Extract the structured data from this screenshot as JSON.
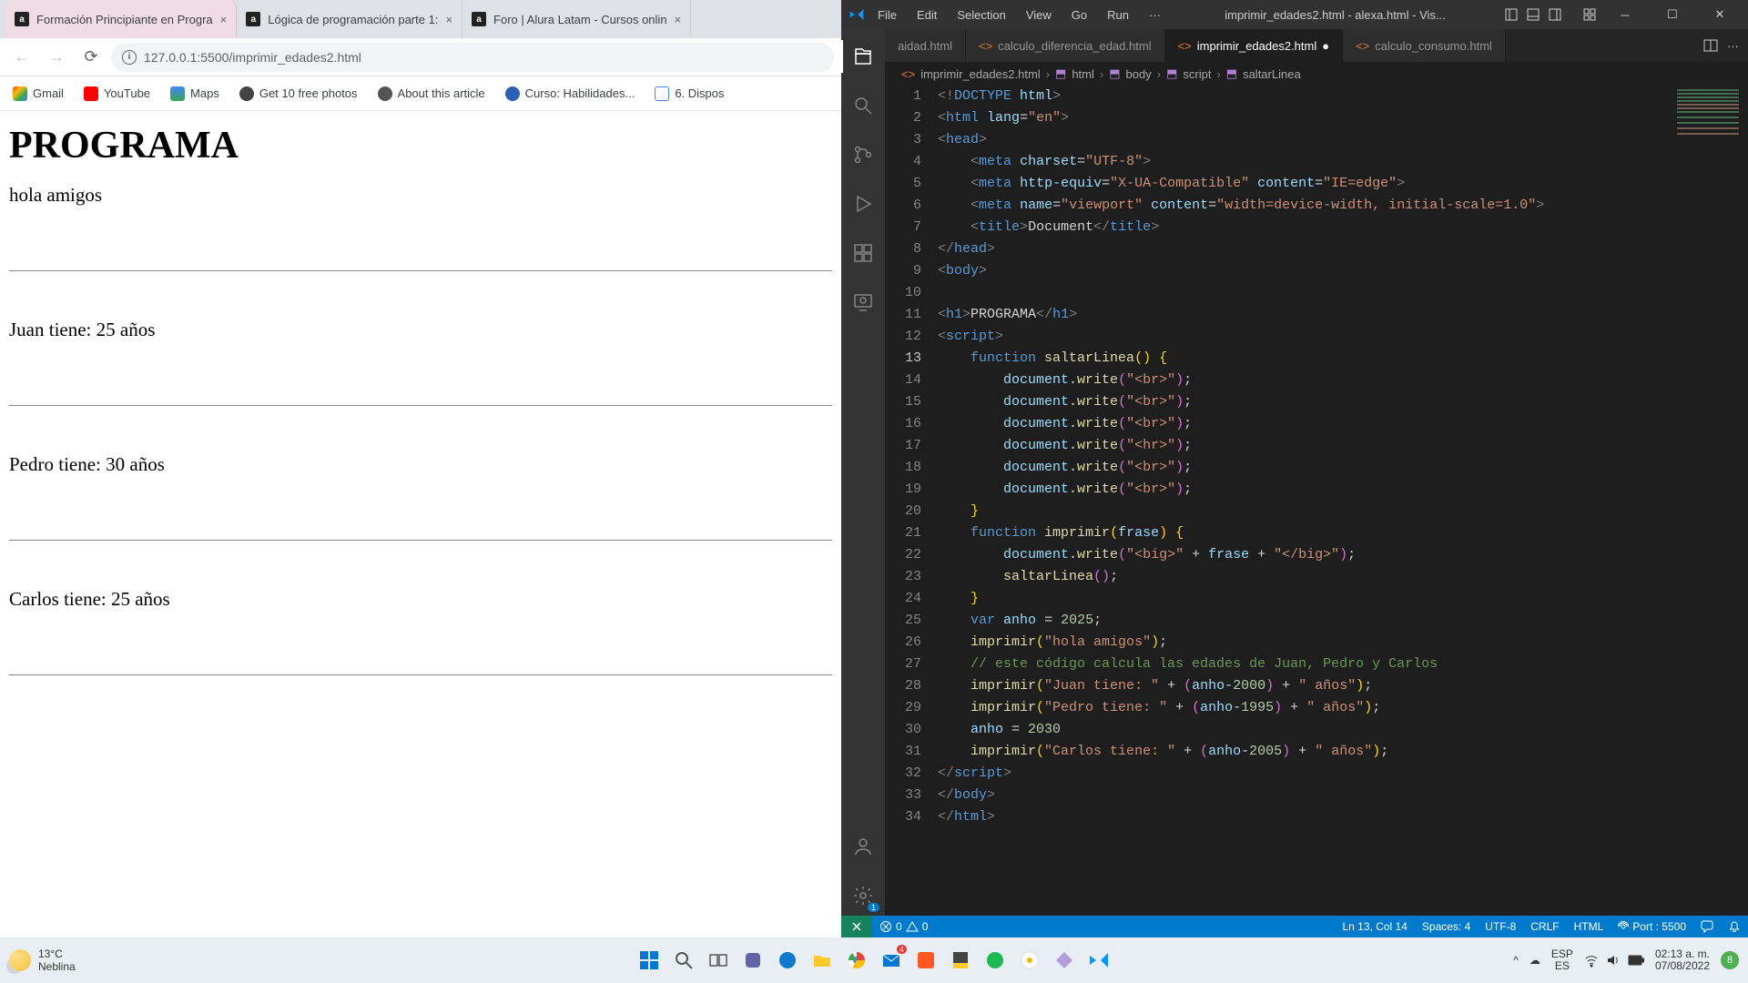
{
  "browser": {
    "tabs": [
      {
        "title": "Formación Principiante en Progra"
      },
      {
        "title": "Lógica de programación parte 1:"
      },
      {
        "title": "Foro | Alura Latam - Cursos onlin"
      }
    ],
    "url": "127.0.0.1:5500/imprimir_edades2.html",
    "bookmarks": [
      {
        "label": "Gmail"
      },
      {
        "label": "YouTube"
      },
      {
        "label": "Maps"
      },
      {
        "label": "Get 10 free photos"
      },
      {
        "label": "About this article"
      },
      {
        "label": "Curso: Habilidades..."
      },
      {
        "label": "6. Dispos"
      }
    ],
    "page": {
      "h1": "PROGRAMA",
      "p1": "hola amigos",
      "p2": "Juan tiene: 25 años",
      "p3": "Pedro tiene: 30 años",
      "p4": "Carlos tiene: 25 años"
    }
  },
  "vscode": {
    "menus": [
      "File",
      "Edit",
      "Selection",
      "View",
      "Go",
      "Run",
      "···"
    ],
    "title": "imprimir_edades2.html - alexa.html - Vis...",
    "editor_tabs": [
      {
        "name": "aidad.html",
        "active": false,
        "dirty": false
      },
      {
        "name": "calculo_diferencia_edad.html",
        "active": false,
        "dirty": false
      },
      {
        "name": "imprimir_edades2.html",
        "active": true,
        "dirty": true
      },
      {
        "name": "calculo_consumo.html",
        "active": false,
        "dirty": false
      }
    ],
    "breadcrumb": {
      "file": "imprimir_edades2.html",
      "p1": "html",
      "p2": "body",
      "p3": "script",
      "p4": "saltarLinea"
    },
    "lines": 34,
    "status": {
      "errors": "0",
      "warnings": "0",
      "cursor": "Ln 13, Col 14",
      "spaces": "Spaces: 4",
      "encoding": "UTF-8",
      "eol": "CRLF",
      "lang": "HTML",
      "port": "Port : 5500"
    }
  },
  "taskbar": {
    "weather_temp": "13°C",
    "weather_desc": "Neblina",
    "lang1": "ESP",
    "lang2": "ES",
    "time": "02:13 a. m.",
    "date": "07/08/2022",
    "notif": "8"
  }
}
